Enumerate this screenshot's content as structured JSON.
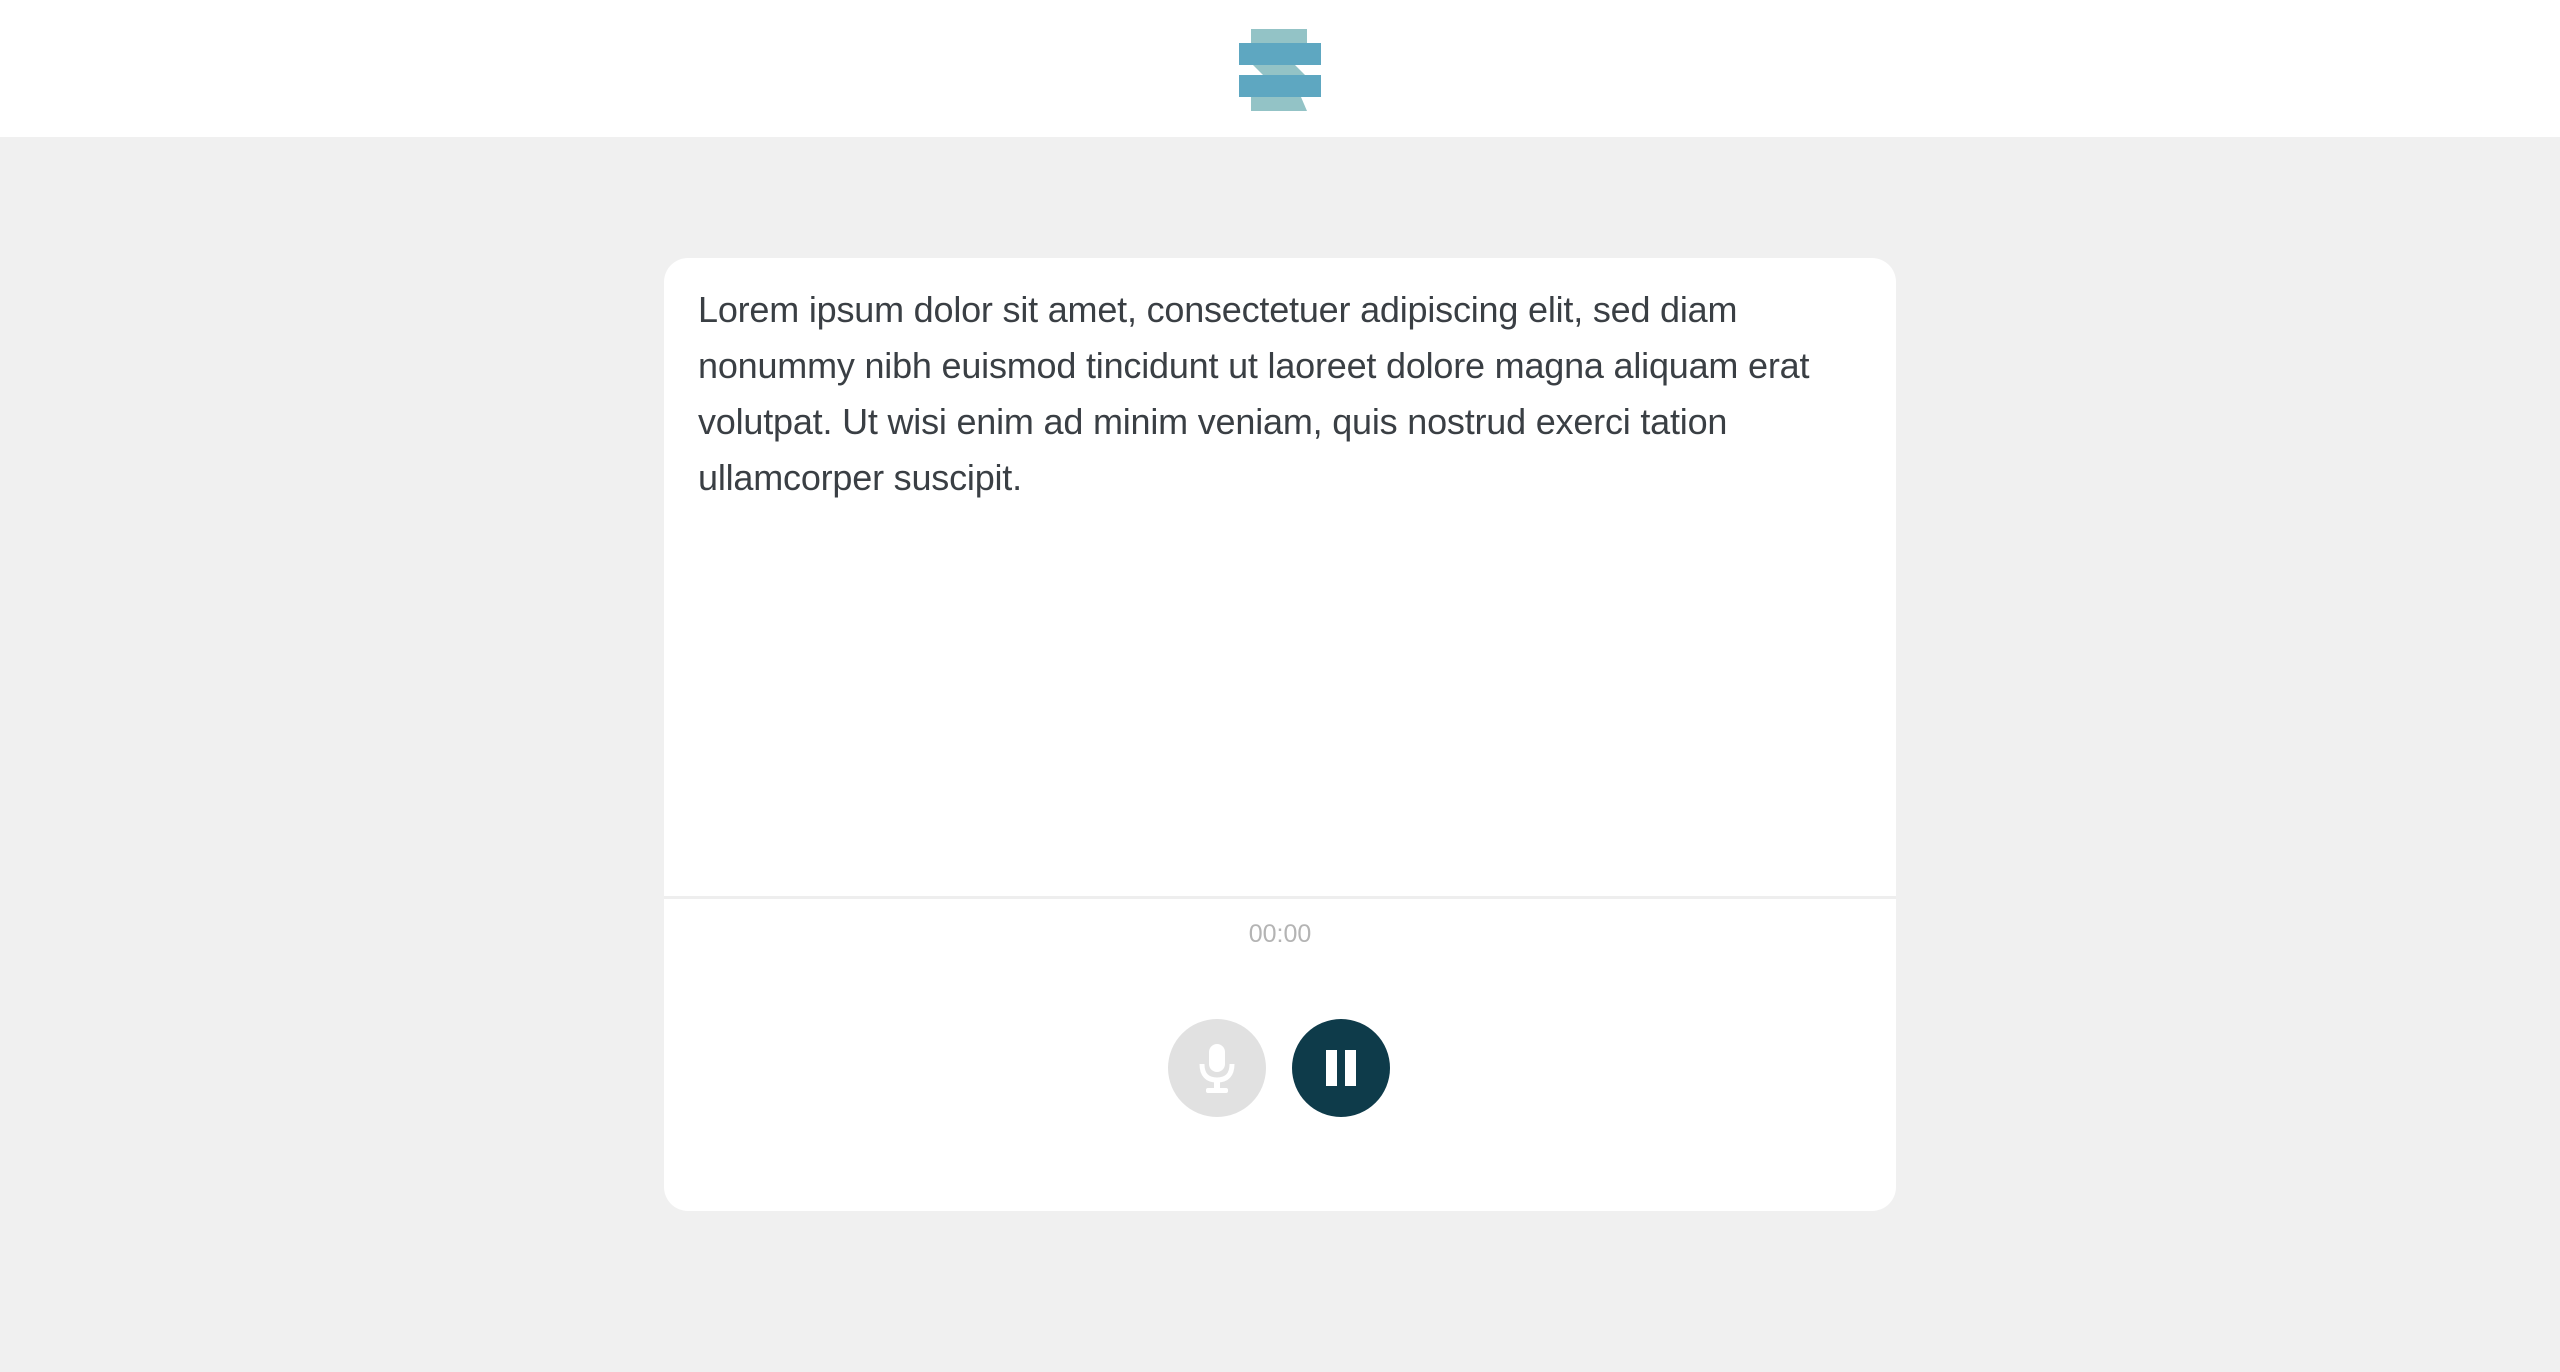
{
  "header": {
    "logo_icon": "stacked-stripes-logo",
    "colors": {
      "bar": "#5ea7c1",
      "shade": "#93c3c6"
    }
  },
  "editor": {
    "text": "Lorem ipsum dolor sit amet, consectetuer adipiscing elit, sed diam nonummy nibh euismod tincidunt ut laoreet dolore magna aliquam erat volutpat. Ut wisi enim ad minim veniam, quis nostrud exerci tation ullamcorper suscipit."
  },
  "recorder": {
    "timer": "00:00",
    "mic_icon": "microphone-icon",
    "pause_icon": "pause-icon",
    "colors": {
      "mic_bg": "#e1e1e1",
      "pause_bg": "#0e3b4a"
    }
  }
}
